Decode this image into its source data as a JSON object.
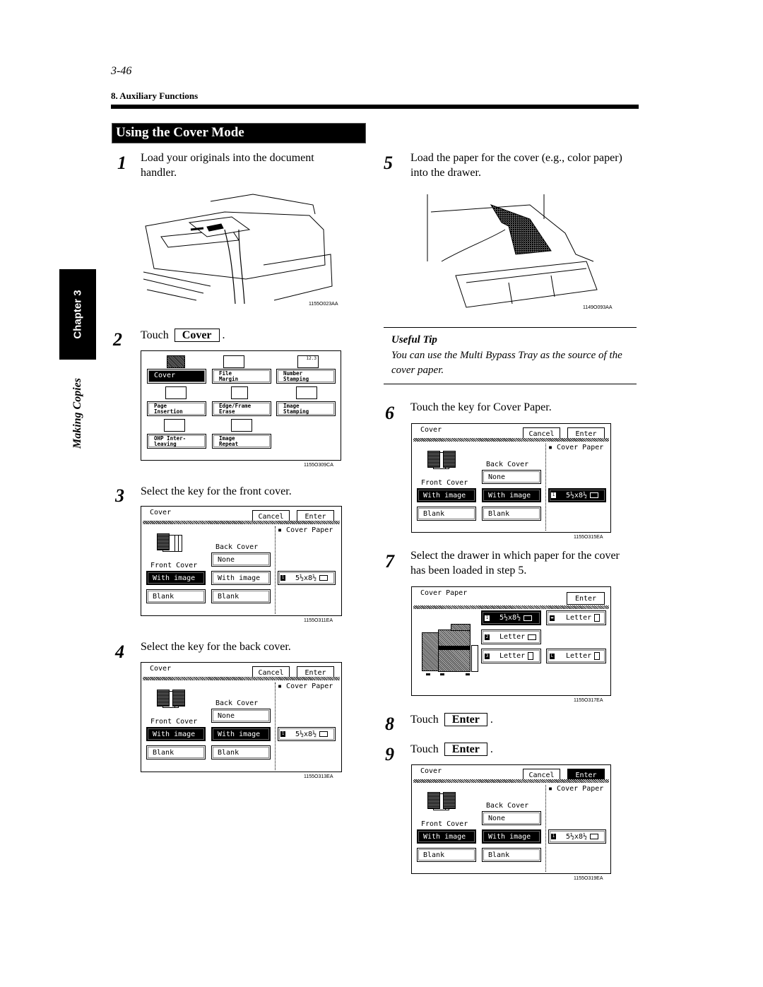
{
  "page": {
    "page_number": "3-46",
    "section_header": "8. Auxiliary Functions",
    "title": "Using the Cover Mode",
    "side_tab": "Chapter 3",
    "side_label": "Making Copies"
  },
  "steps": [
    {
      "num": "1",
      "text": "Load your originals into the document handler.",
      "figure": "1155O023AA"
    },
    {
      "num": "2",
      "prefix": "Touch",
      "key": "Cover",
      "suffix": ".",
      "figure": "1155O309CA"
    },
    {
      "num": "3",
      "text": "Select the key for the front cover.",
      "figure": "1155O311EA"
    },
    {
      "num": "4",
      "text": "Select the key for the back cover.",
      "figure": "1155O313EA"
    },
    {
      "num": "5",
      "text": "Load the paper for the cover (e.g., color paper) into the drawer.",
      "figure": "1149O093AA"
    },
    {
      "num": "6",
      "text": "Touch the key for Cover Paper.",
      "figure": "1155O315EA"
    },
    {
      "num": "7",
      "text": "Select the drawer in which paper for the cover has been loaded in step 5.",
      "figure": "1155O317EA"
    },
    {
      "num": "8",
      "prefix": "Touch",
      "key": "Enter",
      "suffix": "."
    },
    {
      "num": "9",
      "prefix": "Touch",
      "key": "Enter",
      "suffix": ".",
      "figure": "1155O319EA"
    }
  ],
  "useful_tip": {
    "title": "Useful Tip",
    "text": "You can use the Multi Bypass Tray as the source of the cover paper."
  },
  "function_menu": {
    "buttons": [
      {
        "label": "Cover",
        "selected": true,
        "icon": "cover-icon"
      },
      {
        "label": "File\nMargin",
        "selected": false,
        "icon": "file-margin-icon"
      },
      {
        "label": "Number\nStamping",
        "selected": false,
        "icon": "number-stamping-icon",
        "icon_text": "12.3"
      },
      {
        "label": "Page\nInsertion",
        "selected": false,
        "icon": "page-insertion-icon"
      },
      {
        "label": "Edge/Frame\nErase",
        "selected": false,
        "icon": "edge-frame-erase-icon"
      },
      {
        "label": "Image\nStamping",
        "selected": false,
        "icon": "image-stamping-icon"
      },
      {
        "label": "OHP Inter-\nleaving",
        "selected": false,
        "icon": "ohp-interleaving-icon"
      },
      {
        "label": "Image\nRepeat",
        "selected": false,
        "icon": "image-repeat-icon"
      }
    ]
  },
  "cover_panel": {
    "title": "Cover",
    "cancel": "Cancel",
    "enter": "Enter",
    "cover_paper_label": "Cover Paper",
    "back_cover_label": "Back Cover",
    "front_cover_label": "Front Cover",
    "none": "None",
    "with_image": "With image",
    "blank": "Blank",
    "paper_tray": "1",
    "paper_size": "5½x8½"
  },
  "cover_paper_panel": {
    "title": "Cover Paper",
    "enter": "Enter",
    "trays": [
      {
        "tray": "1",
        "size": "5½x8½",
        "orientation": "landscape",
        "selected": true
      },
      {
        "tray": "bypass",
        "size": "Letter",
        "orientation": "portrait",
        "selected": false
      },
      {
        "tray": "2",
        "size": "Letter",
        "orientation": "landscape",
        "selected": false
      },
      {
        "tray": "3",
        "size": "Letter",
        "orientation": "portrait",
        "selected": false
      },
      {
        "tray": "LCC",
        "size": "Letter",
        "orientation": "portrait",
        "selected": false
      }
    ]
  }
}
